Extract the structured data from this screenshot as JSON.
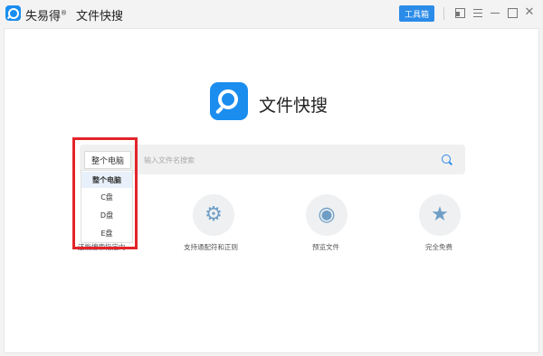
{
  "titlebar": {
    "brand": "失易得",
    "brand_mark": "®",
    "app_title": "文件快搜",
    "toolbox_label": "工具箱"
  },
  "hero": {
    "title": "文件快搜"
  },
  "search": {
    "scope_value": "整个电脑",
    "placeholder": "输入文件名搜索"
  },
  "dropdown": {
    "options": [
      "整个电脑",
      "C盘",
      "D盘",
      "E盘"
    ],
    "selected_index": 0
  },
  "features": [
    {
      "label": "支持通配符和正则",
      "icon": "gear-icon"
    },
    {
      "label": "预览文件",
      "icon": "eye-icon"
    },
    {
      "label": "完全免费",
      "icon": "star-icon"
    }
  ],
  "obscured_feature_label": "还能搜索指定内",
  "colors": {
    "accent": "#2b8be8",
    "highlight_box": "#e3242b",
    "icon_tint": "#6e9ec6"
  }
}
